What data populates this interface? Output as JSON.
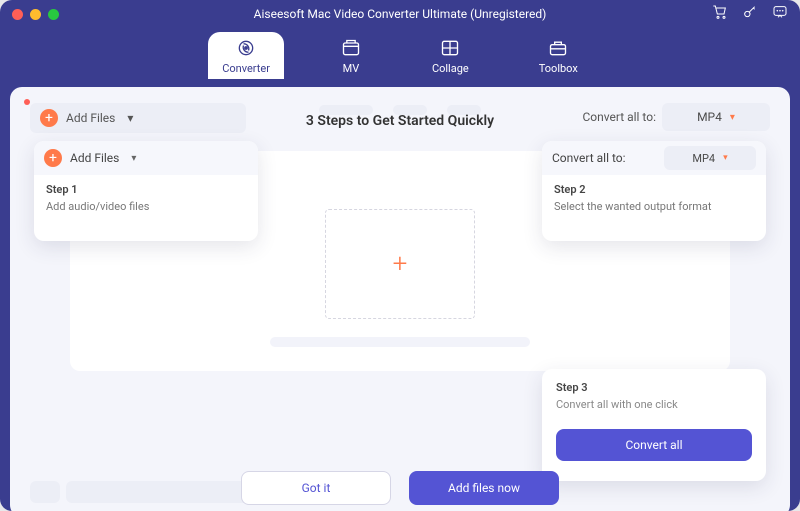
{
  "window": {
    "title": "Aiseesoft Mac Video Converter Ultimate (Unregistered)"
  },
  "tabs": {
    "converter": "Converter",
    "mv": "MV",
    "collage": "Collage",
    "toolbox": "Toolbox"
  },
  "toolbar": {
    "add_files": "Add Files",
    "convert_all_to": "Convert all to:",
    "output_format": "MP4"
  },
  "onboarding": {
    "heading": "3 Steps to Get Started Quickly",
    "step1": {
      "title": "Step 1",
      "desc": "Add audio/video files",
      "add_files": "Add Files"
    },
    "step2": {
      "title": "Step 2",
      "desc": "Select the wanted output format",
      "convert_all_to": "Convert all to:",
      "output_format": "MP4"
    },
    "step3": {
      "title": "Step 3",
      "desc": "Convert all with one click",
      "cta": "Convert all"
    },
    "got_it": "Got it",
    "add_files_now": "Add files now"
  }
}
